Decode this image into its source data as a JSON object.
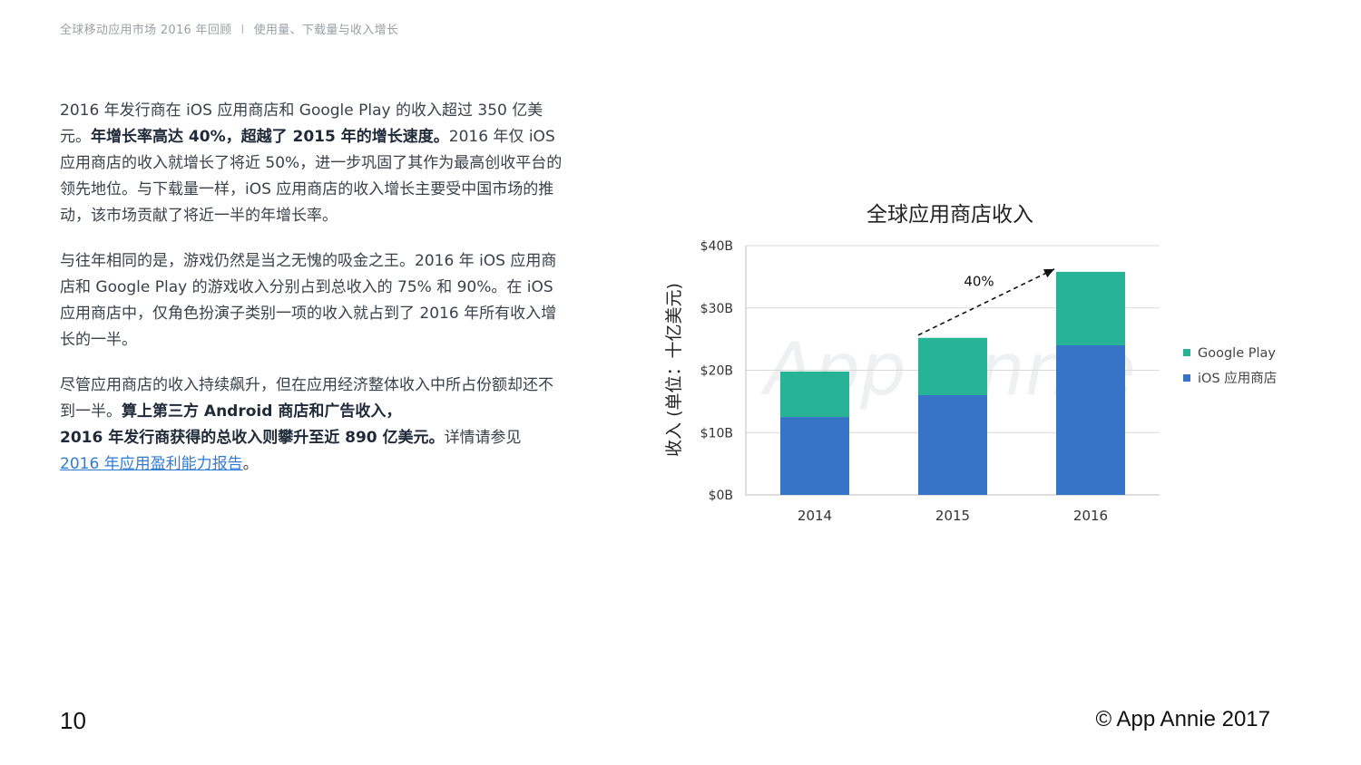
{
  "header": {
    "left": "全球移动应用市场 2016 年回顾",
    "separator": "I",
    "right": "使用量、下载量与收入增长"
  },
  "paragraphs": {
    "p1": {
      "t1": "2016 年发行商在 iOS 应用商店和 Google Play 的收入超过 350 亿美元。",
      "b1": "年增长率高达 40%，超越了 2015 年的增长速度。",
      "t2": "2016 年仅 iOS 应用商店的收入就增长了将近 50%，进一步巩固了其作为最高创收平台的领先地位。与下载量一样，iOS 应用商店的收入增长主要受中国市场的推动，该市场贡献了将近一半的年增长率。"
    },
    "p2": {
      "t1": "与往年相同的是，游戏仍然是当之无愧的吸金之王。2016 年 iOS 应用商店和 Google Play 的游戏收入分别占到总收入的 75% 和 90%。在 iOS 应用商店中，仅角色扮演子类别一项的收入就占到了 2016 年所有收入增长的一半。"
    },
    "p3": {
      "t1": "尽管应用商店的收入持续飙升，但在应用经济整体收入中所占份额却还不到一半。",
      "b1": "算上第三方 Android 商店和广告收入，",
      "b2": "2016 年发行商获得的总收入则攀升至近 890 亿美元。",
      "t2": "详情请参见",
      "link": "2016 年应用盈利能力报告",
      "t3": "。"
    }
  },
  "chart_data": {
    "type": "bar",
    "stacked": true,
    "title": "全球应用商店收入",
    "ylabel": "收入 (单位：十亿美元)",
    "xlabel": "",
    "categories": [
      "2014",
      "2015",
      "2016"
    ],
    "series": [
      {
        "name": "iOS 应用商店",
        "values": [
          12.5,
          16,
          24
        ],
        "color": "#3774c7"
      },
      {
        "name": "Google Play",
        "values": [
          7.3,
          9.2,
          11.8
        ],
        "color": "#26b396"
      }
    ],
    "ylim": [
      0,
      40
    ],
    "yticks": [
      0,
      10,
      20,
      30,
      40
    ],
    "ytick_labels": [
      "$0B",
      "$10B",
      "$20B",
      "$30B",
      "$40B"
    ],
    "legend_position": "right",
    "legend_order": [
      "Google Play",
      "iOS 应用商店"
    ],
    "grid": true,
    "annotation": {
      "text": "40%",
      "from": "2015",
      "to": "2016",
      "style": "dashed-arrow"
    },
    "watermark": "App Annie"
  },
  "footer": {
    "page_number": "10",
    "copyright": "© App Annie 2017"
  }
}
